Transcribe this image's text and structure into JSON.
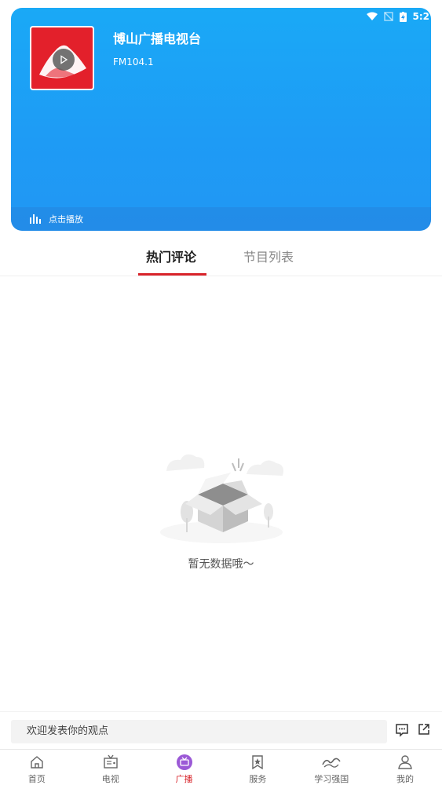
{
  "status_bar": {
    "time": "5:2"
  },
  "station": {
    "title": "博山广播电视台",
    "frequency": "FM104.1",
    "play_label": "点击播放",
    "logo_icon": "station-logo-icon"
  },
  "tabs": [
    {
      "label": "热门评论",
      "active": true
    },
    {
      "label": "节目列表",
      "active": false
    }
  ],
  "empty_state": {
    "text": "暂无数据哦～",
    "icon": "empty-box-icon"
  },
  "comment_bar": {
    "placeholder": "欢迎发表你的观点"
  },
  "nav": {
    "items": [
      {
        "label": "首页",
        "icon": "home-icon"
      },
      {
        "label": "电视",
        "icon": "tv-icon"
      },
      {
        "label": "广播",
        "icon": "radio-icon",
        "active": true
      },
      {
        "label": "服务",
        "icon": "bookmark-star-icon"
      },
      {
        "label": "学习强国",
        "icon": "xuexi-logo-icon"
      },
      {
        "label": "我的",
        "icon": "user-icon"
      }
    ]
  },
  "colors": {
    "header_gradient_start": "#1aa9f6",
    "header_gradient_end": "#2197f4",
    "accent": "#d8232a",
    "logo_red": "#e3202b"
  }
}
